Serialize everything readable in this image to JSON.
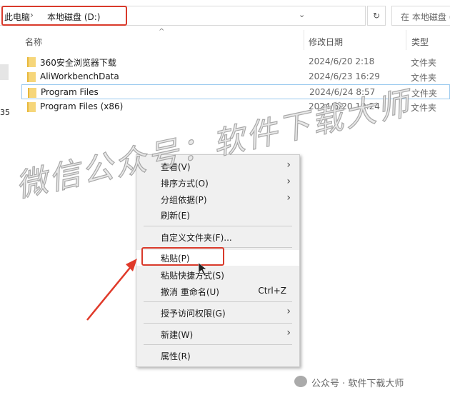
{
  "address": {
    "crumbs": [
      "此电脑",
      "本地磁盘 (D:)"
    ],
    "separator": "›",
    "dropdown": "⌄",
    "refresh": "↻",
    "search_placeholder": "在 本地磁盘 (D:)"
  },
  "sidebar": {
    "partial_text": "35"
  },
  "columns": {
    "name": "名称",
    "date": "修改日期",
    "type": "类型"
  },
  "files": [
    {
      "name": "360安全浏览器下载",
      "date": "2024/6/20 2:18",
      "type": "文件夹"
    },
    {
      "name": "AliWorkbenchData",
      "date": "2024/6/23 16:29",
      "type": "文件夹"
    },
    {
      "name": "Program Files",
      "date": "2024/6/24 8:57",
      "type": "文件夹"
    },
    {
      "name": "Program Files (x86)",
      "date": "2024/6/20 19:24",
      "type": "文件夹"
    }
  ],
  "menu": {
    "view": "查看(V)",
    "sort": "排序方式(O)",
    "group": "分组依据(P)",
    "refresh": "刷新(E)",
    "customize": "自定义文件夹(F)...",
    "paste": "粘贴(P)",
    "paste_shortcut": "粘贴快捷方式(S)",
    "undo": "撤消 重命名(U)",
    "undo_shortcut": "Ctrl+Z",
    "grant": "授予访问权限(G)",
    "new": "新建(W)",
    "properties": "属性(R)",
    "submenu_arrow": "›"
  },
  "watermark": "微信公众号：软件下载大师",
  "footer": "公众号 · 软件下载大师",
  "colors": {
    "highlight": "#d93a2b",
    "selection": "#99c9ef"
  }
}
